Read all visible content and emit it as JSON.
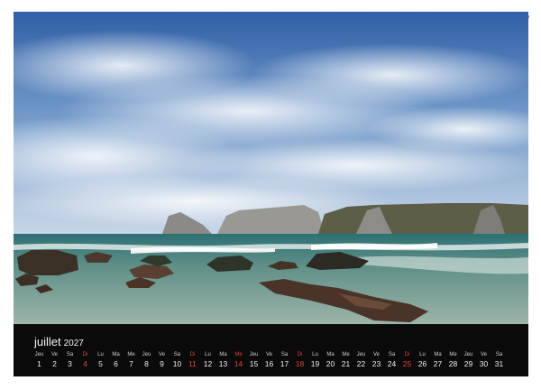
{
  "calendar": {
    "month": "juillet",
    "year": "2027",
    "days": [
      {
        "wd": "Jeu",
        "n": "1"
      },
      {
        "wd": "Ve",
        "n": "2"
      },
      {
        "wd": "Sa",
        "n": "3"
      },
      {
        "wd": "Di",
        "n": "4",
        "sun": true
      },
      {
        "wd": "Lu",
        "n": "5"
      },
      {
        "wd": "Ma",
        "n": "6"
      },
      {
        "wd": "Me",
        "n": "7"
      },
      {
        "wd": "Jeu",
        "n": "8"
      },
      {
        "wd": "Ve",
        "n": "9"
      },
      {
        "wd": "Sa",
        "n": "10"
      },
      {
        "wd": "Di",
        "n": "11",
        "sun": true
      },
      {
        "wd": "Lu",
        "n": "12"
      },
      {
        "wd": "Ma",
        "n": "13"
      },
      {
        "wd": "Me",
        "n": "14",
        "sun": true
      },
      {
        "wd": "Jeu",
        "n": "15"
      },
      {
        "wd": "Ve",
        "n": "16"
      },
      {
        "wd": "Sa",
        "n": "17"
      },
      {
        "wd": "Di",
        "n": "18",
        "sun": true
      },
      {
        "wd": "Lu",
        "n": "19"
      },
      {
        "wd": "Ma",
        "n": "20"
      },
      {
        "wd": "Me",
        "n": "21"
      },
      {
        "wd": "Jeu",
        "n": "22"
      },
      {
        "wd": "Ve",
        "n": "23"
      },
      {
        "wd": "Sa",
        "n": "24"
      },
      {
        "wd": "Di",
        "n": "25",
        "sun": true
      },
      {
        "wd": "Lu",
        "n": "26"
      },
      {
        "wd": "Ma",
        "n": "27"
      },
      {
        "wd": "Me",
        "n": "28"
      },
      {
        "wd": "Jeu",
        "n": "29"
      },
      {
        "wd": "Ve",
        "n": "30"
      },
      {
        "wd": "Sa",
        "n": "31"
      }
    ]
  },
  "colors": {
    "bar_background": "#0a0a0a",
    "text": "#f2f2f2",
    "holiday": "#e0463c"
  },
  "icons": {
    "binding": "spiral-binding-icon",
    "hanger": "wall-hanger-icon"
  }
}
